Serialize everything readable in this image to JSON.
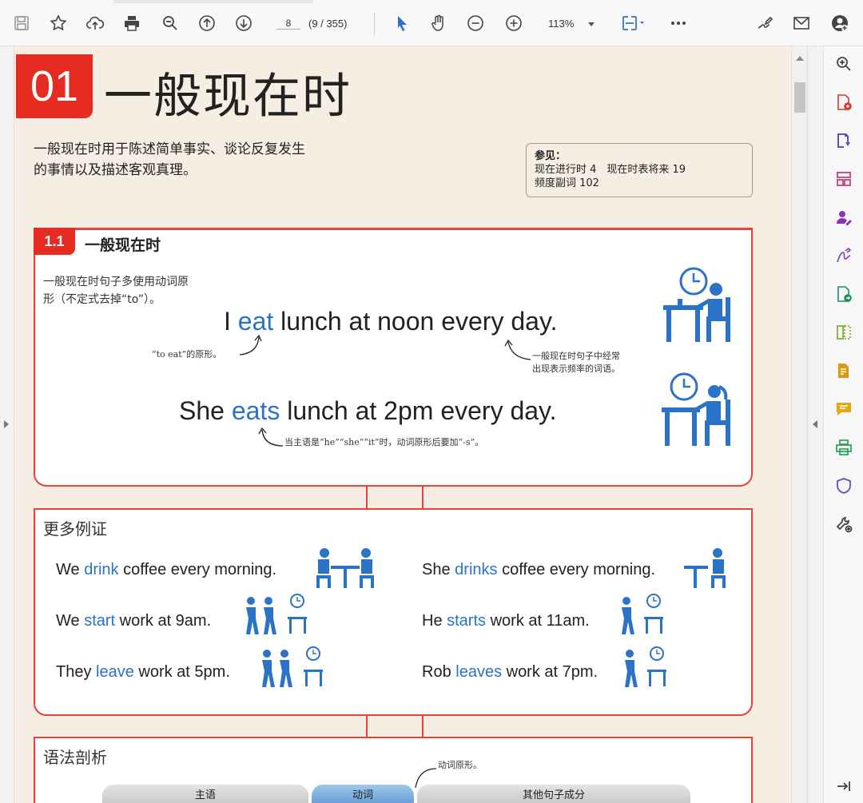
{
  "toolbar": {
    "page_input": "8",
    "page_count": "(9 / 355)",
    "zoom": "113%",
    "icons": [
      "save-icon",
      "bookmark-star-icon",
      "cloud-upload-icon",
      "print-icon",
      "zoom-search-icon",
      "prev-page-icon",
      "next-page-icon",
      "select-cursor-icon",
      "hand-tool-icon",
      "zoom-out-icon",
      "zoom-in-icon",
      "fit-page-icon",
      "more-icon",
      "sign-icon",
      "email-icon",
      "account-icon"
    ],
    "accent": "#2b73c6"
  },
  "document": {
    "unit_number": "01",
    "unit_title": "一般现在时",
    "intro_line1": "一般现在时用于陈述简单事实、谈论反复发生",
    "intro_line2": "的事情以及描述客观真理。",
    "ref_title": "参见：",
    "ref_line1": "现在进行时 4　现在时表将来 19",
    "ref_line2": "频度副词 102",
    "section": {
      "number": "1.1",
      "title": "一般现在时",
      "rule_line1": "一般现在时句子多使用动词原",
      "rule_line2": "形（不定式去掉“to”）。",
      "s1_pre": "I ",
      "s1_verb": "eat",
      "s1_post": " lunch at noon every day.",
      "note_left": "“to eat”的原形。",
      "note_right1": "一般现在时句子中经常",
      "note_right2": "出现表示频率的词语。",
      "s2_pre": "She ",
      "s2_verb": "eats",
      "s2_post": " lunch at 2pm every day.",
      "note_bottom": "当主语是“he”“she”“it”时，动词原形后要加“-s”。"
    },
    "more_examples": {
      "title": "更多例证",
      "items": [
        {
          "pre": "We ",
          "verb": "drink",
          "post": " coffee every morning."
        },
        {
          "pre": "She ",
          "verb": "drinks",
          "post": " coffee every morning."
        },
        {
          "pre": "We ",
          "verb": "start",
          "post": " work at 9am."
        },
        {
          "pre": "He ",
          "verb": "starts",
          "post": " work at 11am."
        },
        {
          "pre": "They ",
          "verb": "leave",
          "post": " work at 5pm."
        },
        {
          "pre": "Rob ",
          "verb": "leaves",
          "post": " work at 7pm."
        }
      ]
    },
    "grammar": {
      "title": "语法剖析",
      "note": "动词原形。",
      "subject": "主语",
      "verb": "动词",
      "other": "其他句子成分"
    }
  }
}
